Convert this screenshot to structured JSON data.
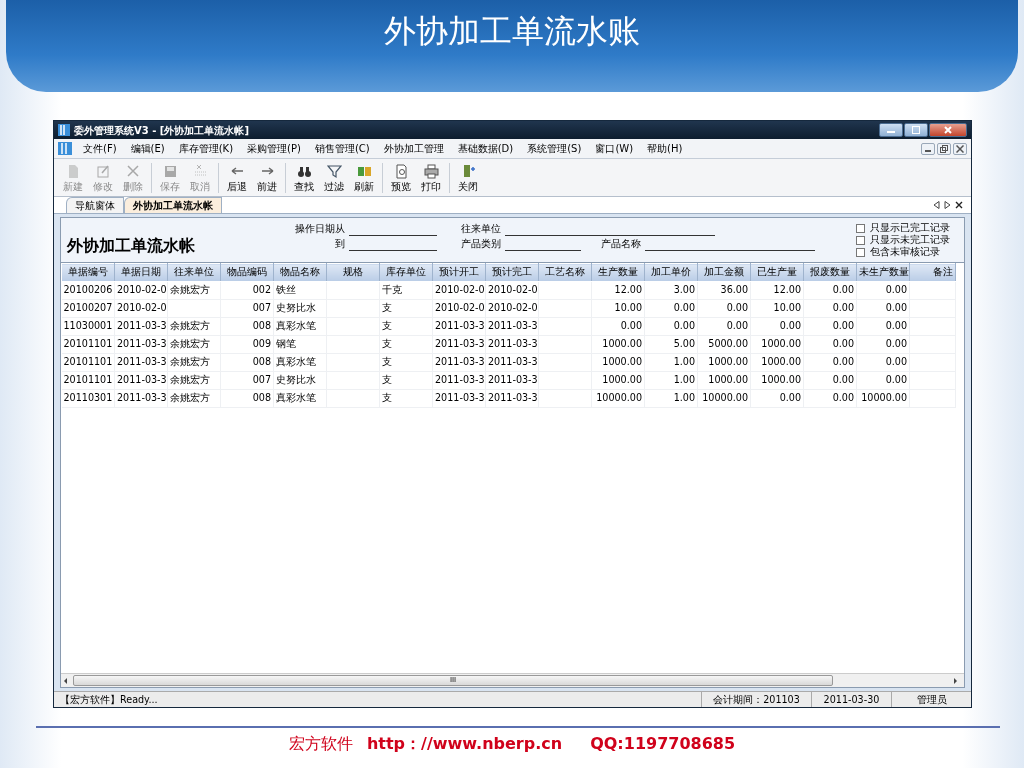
{
  "slide_title": "外协加工单流水账",
  "window": {
    "title": "委外管理系统V3 - [外协加工单流水帐]"
  },
  "menu": [
    "文件(F)",
    "编辑(E)",
    "库存管理(K)",
    "采购管理(P)",
    "销售管理(C)",
    "外协加工管理",
    "基础数据(D)",
    "系统管理(S)",
    "窗口(W)",
    "帮助(H)"
  ],
  "toolbar": [
    {
      "label": "新建",
      "disabled": true
    },
    {
      "label": "修改",
      "disabled": true
    },
    {
      "label": "删除",
      "disabled": true
    },
    {
      "label": "保存",
      "disabled": true
    },
    {
      "label": "取消",
      "disabled": true
    },
    {
      "label": "后退",
      "disabled": false
    },
    {
      "label": "前进",
      "disabled": false
    },
    {
      "label": "查找",
      "disabled": false
    },
    {
      "label": "过滤",
      "disabled": false
    },
    {
      "label": "刷新",
      "disabled": false
    },
    {
      "label": "预览",
      "disabled": false
    },
    {
      "label": "打印",
      "disabled": false
    },
    {
      "label": "关闭",
      "disabled": false
    }
  ],
  "tabs": [
    {
      "label": "导航窗体",
      "selected": false
    },
    {
      "label": "外协加工单流水帐",
      "selected": true
    }
  ],
  "report_title": "外协加工单流水帐",
  "filters": [
    {
      "label": "操作日期从"
    },
    {
      "label": "到"
    },
    {
      "label": "往来单位"
    },
    {
      "label": "产品类别"
    },
    {
      "label": "产品名称"
    }
  ],
  "options": [
    {
      "label": "只显示已完工记录",
      "checked": false
    },
    {
      "label": "只显示未完工记录",
      "checked": false
    },
    {
      "label": "包含未审核记录",
      "checked": false
    }
  ],
  "table": {
    "columns": [
      "单据编号",
      "单据日期",
      "往来单位",
      "物品编码",
      "物品名称",
      "规格",
      "库存单位",
      "预计开工",
      "预计完工",
      "工艺名称",
      "生产数量",
      "加工单价",
      "加工金额",
      "已生产量",
      "报废数量",
      "未生产数量",
      "备注"
    ],
    "rows": [
      {
        "cells": [
          "20100206",
          "2010-02-0",
          "余姚宏方",
          "002",
          "铁丝",
          null,
          "千克",
          "2010-02-0",
          "2010-02-0",
          null,
          "12.00",
          "3.00",
          "36.00",
          "12.00",
          "0.00",
          "0.00",
          null
        ]
      },
      {
        "cells": [
          "20100207",
          "2010-02-0",
          null,
          "007",
          "史努比水",
          null,
          "支",
          "2010-02-0",
          "2010-02-0",
          null,
          "10.00",
          "0.00",
          "0.00",
          "10.00",
          "0.00",
          "0.00",
          null
        ]
      },
      {
        "cells": [
          "11030001",
          "2011-03-3",
          "余姚宏方",
          "008",
          "真彩水笔",
          null,
          "支",
          "2011-03-3",
          "2011-03-3",
          null,
          "0.00",
          "0.00",
          "0.00",
          "0.00",
          "0.00",
          "0.00",
          null
        ]
      },
      {
        "cells": [
          "20101101",
          "2011-03-3",
          "余姚宏方",
          "009",
          "钢笔",
          null,
          "支",
          "2011-03-3",
          "2011-03-3",
          null,
          "1000.00",
          "5.00",
          "5000.00",
          "1000.00",
          "0.00",
          "0.00",
          null
        ]
      },
      {
        "cells": [
          "20101101",
          "2011-03-3",
          "余姚宏方",
          "008",
          "真彩水笔",
          null,
          "支",
          "2011-03-3",
          "2011-03-3",
          null,
          "1000.00",
          "1.00",
          "1000.00",
          "1000.00",
          "0.00",
          "0.00",
          null
        ]
      },
      {
        "cells": [
          "20101101",
          "2011-03-3",
          "余姚宏方",
          "007",
          "史努比水",
          null,
          "支",
          "2011-03-3",
          "2011-03-3",
          null,
          "1000.00",
          "1.00",
          "1000.00",
          "1000.00",
          "0.00",
          "0.00",
          null
        ]
      },
      {
        "cells": [
          "20110301",
          "2011-03-3",
          "余姚宏方",
          "008",
          "真彩水笔",
          null,
          "支",
          "2011-03-3",
          "2011-03-3",
          null,
          "10000.00",
          "1.00",
          "10000.00",
          "0.00",
          "0.00",
          "10000.00",
          null
        ]
      }
    ]
  },
  "scrollbar_grip": "III",
  "status_bar": [
    "【宏方软件】Ready...",
    "会计期间：201103",
    "2011-03-30",
    "管理员"
  ],
  "footer": [
    "宏方软件",
    "http：//www.nberp.cn",
    "QQ:1197708685"
  ]
}
